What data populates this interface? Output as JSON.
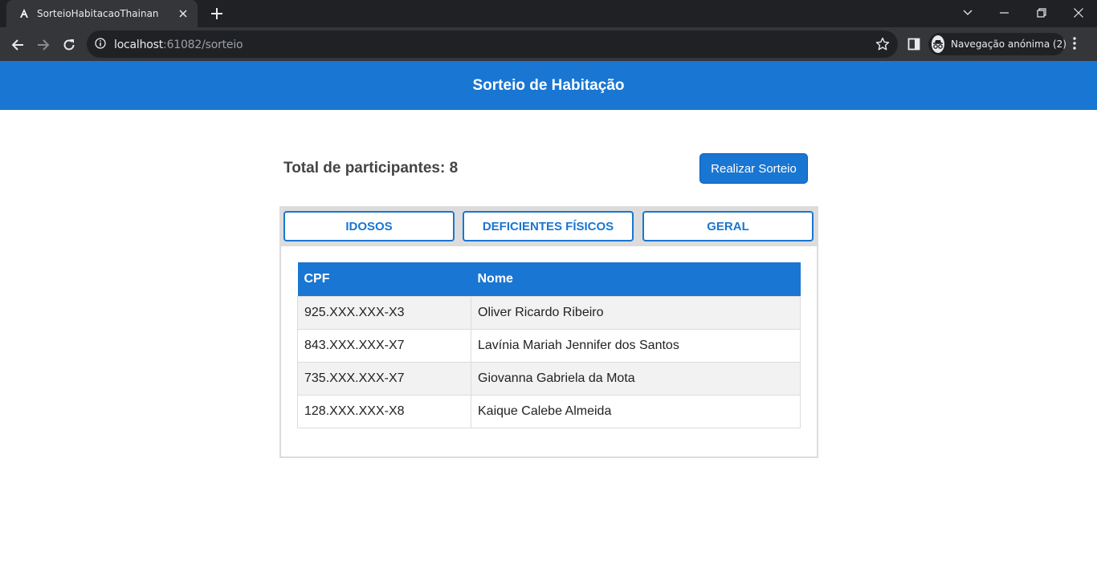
{
  "browser": {
    "tab_title": "SorteioHabitacaoThainan",
    "url_host": "localhost",
    "url_rest": ":61082/sorteio",
    "incognito_label": "Navegação anónima (2)",
    "icons": [
      "angular-favicon",
      "close-icon",
      "plus-icon",
      "chevron-down-icon",
      "minimize-icon",
      "restore-icon",
      "close-window-icon",
      "back-arrow-icon",
      "forward-arrow-icon",
      "reload-icon",
      "info-icon",
      "star-icon",
      "side-panel-icon",
      "incognito-icon",
      "kebab-menu-icon"
    ]
  },
  "app": {
    "title": "Sorteio de Habitação",
    "accent_color": "#1976d2",
    "total_label": "Total de participantes: 8",
    "draw_button": "Realizar Sorteio",
    "tabs": [
      "IDOSOS",
      "DEFICIENTES FÍSICOS",
      "GERAL"
    ],
    "table": {
      "headers": [
        "CPF",
        "Nome"
      ],
      "rows": [
        [
          "925.XXX.XXX-X3",
          "Oliver Ricardo Ribeiro"
        ],
        [
          "843.XXX.XXX-X7",
          "Lavínia Mariah Jennifer dos Santos"
        ],
        [
          "735.XXX.XXX-X7",
          "Giovanna Gabriela da Mota"
        ],
        [
          "128.XXX.XXX-X8",
          "Kaique Calebe Almeida"
        ]
      ]
    }
  }
}
